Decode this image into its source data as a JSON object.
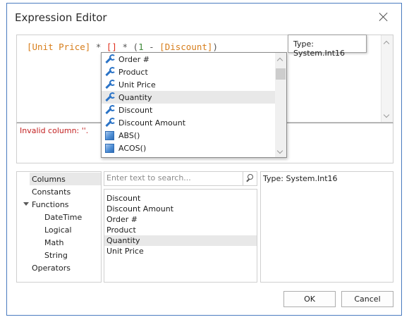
{
  "window": {
    "title": "Expression Editor"
  },
  "editor": {
    "expression": {
      "part1": "[Unit Price]",
      "part2": " * ",
      "caret": "[]",
      "part3": " * (",
      "num": "1",
      "part4": " - ",
      "part5": "[Discount]",
      "part6": ")"
    }
  },
  "tooltip": {
    "text": "Type: System.Int16"
  },
  "error": {
    "text": "Invalid column: ''."
  },
  "popup": {
    "items": [
      {
        "label": "Order #",
        "icon": "wrench-icon"
      },
      {
        "label": "Product",
        "icon": "wrench-icon"
      },
      {
        "label": "Unit Price",
        "icon": "wrench-icon"
      },
      {
        "label": "Quantity",
        "icon": "wrench-icon",
        "selected": true
      },
      {
        "label": "Discount",
        "icon": "wrench-icon"
      },
      {
        "label": "Discount Amount",
        "icon": "wrench-icon"
      },
      {
        "label": "ABS()",
        "icon": "function-cube-icon"
      },
      {
        "label": "ACOS()",
        "icon": "function-cube-icon"
      }
    ]
  },
  "categories": {
    "items": [
      {
        "label": "Columns",
        "selected": true
      },
      {
        "label": "Constants"
      },
      {
        "label": "Functions",
        "expanded": true
      },
      {
        "label": "DateTime"
      },
      {
        "label": "Logical"
      },
      {
        "label": "Math"
      },
      {
        "label": "String"
      },
      {
        "label": "Operators"
      }
    ]
  },
  "search": {
    "placeholder": "Enter text to search..."
  },
  "columns": {
    "items": [
      {
        "label": "Discount"
      },
      {
        "label": "Discount Amount"
      },
      {
        "label": "Order #"
      },
      {
        "label": "Product"
      },
      {
        "label": "Quantity",
        "selected": true
      },
      {
        "label": "Unit Price"
      }
    ]
  },
  "description": {
    "text": "Type: System.Int16"
  },
  "buttons": {
    "ok": "OK",
    "cancel": "Cancel"
  },
  "colors": {
    "column_token": "#d77d1a",
    "number_token": "#3f8a3a",
    "error_text": "#c32222",
    "icon_blue": "#2a73c7",
    "selection": "#e8e8e8",
    "window_border": "#4a7bbf"
  }
}
